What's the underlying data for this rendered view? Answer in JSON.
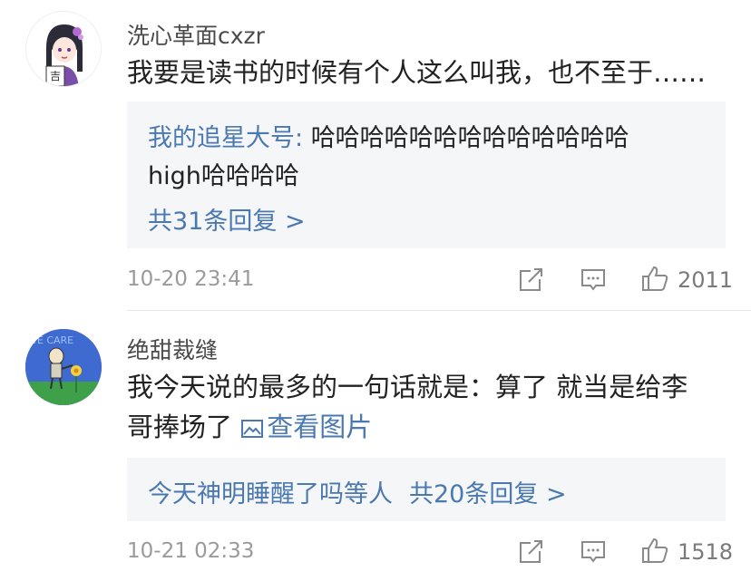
{
  "comments": [
    {
      "username": "洗心革面cxzr",
      "text": "我要是读书的时候有个人这么叫我，也不至于……",
      "reply": {
        "user": "我的追星大号",
        "separator": ": ",
        "text_line1": "哈哈哈哈哈哈哈哈哈哈哈哈哈",
        "text_line2": "high哈哈哈哈",
        "more": "共31条回复 >"
      },
      "timestamp": "10-20 23:41",
      "likes": "2011",
      "avatar_icon": "anime-girl-avatar",
      "avatar_char": "吉"
    },
    {
      "username": "绝甜裁缝",
      "text_line1": "我今天说的最多的一句话就是：算了 就当是给李",
      "text_line2": "哥捧场了 ",
      "view_image": "查看图片",
      "reply": {
        "text": "今天神明睡醒了吗等人",
        "more": "共20条回复 >"
      },
      "timestamp": "10-21 02:33",
      "likes": "1518",
      "avatar_icon": "cartoon-flower-avatar",
      "avatar_text": "WE CARE"
    }
  ],
  "colors": {
    "link": "#4a78b0",
    "text": "#222222",
    "muted": "#9a9a9a",
    "reply_bg": "#f5f6f8"
  },
  "icons": [
    "share-icon",
    "comment-icon",
    "thumbs-up-icon"
  ]
}
